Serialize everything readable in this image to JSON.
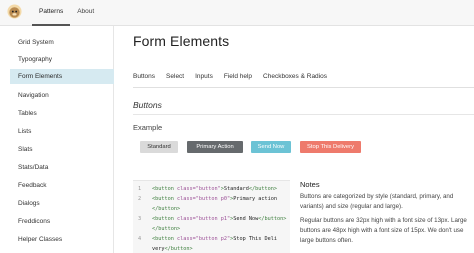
{
  "topnav": {
    "logo_icon": "monkey-logo-icon",
    "items": [
      "Patterns",
      "About"
    ]
  },
  "sidebar": {
    "items": [
      "Grid System",
      "Typography",
      "Form Elements",
      "Navigation",
      "Tables",
      "Lists",
      "Slats",
      "Stats/Data",
      "Feedback",
      "Dialogs",
      "Freddicons",
      "Helper Classes"
    ],
    "active_index": 2
  },
  "main": {
    "title": "Form Elements",
    "tabs": [
      "Buttons",
      "Select",
      "Inputs",
      "Field help",
      "Checkboxes & Radios"
    ],
    "section_title": "Buttons",
    "example_label": "Example",
    "buttons": {
      "standard": "Standard",
      "primary": "Primary Action",
      "send": "Send Now",
      "stop": "Stop This Delivery"
    },
    "colors": {
      "standard": "#dadada",
      "primary": "#666a6d",
      "send": "#6cc3d5",
      "stop": "#ee7a6c",
      "active_nav": "#d6eaf1"
    },
    "code": {
      "line_numbers": [
        "1",
        "2",
        "",
        "3",
        "",
        "4",
        ""
      ],
      "lines": [
        {
          "open": "<button ",
          "attr": "class=\"button\"",
          "close": ">",
          "text": "Standard",
          "end": "</button>"
        },
        {
          "open": "<button ",
          "attr": "class=\"button p0\"",
          "close": ">",
          "text": "Primary action",
          "end": ""
        },
        {
          "open": "",
          "attr": "",
          "close": "",
          "text": "",
          "end": "</button>"
        },
        {
          "open": "<button ",
          "attr": "class=\"button p1\"",
          "close": ">",
          "text": "Send Now",
          "end": "</button>"
        },
        {
          "open": "",
          "attr": "",
          "close": "",
          "text": "",
          "end": "</button>"
        },
        {
          "open": "<button ",
          "attr": "class=\"button p2\"",
          "close": ">",
          "text": "Stop This Deli",
          "end": ""
        },
        {
          "open": "",
          "attr": "",
          "close": "",
          "text": "very",
          "end": "</button>"
        }
      ]
    },
    "notes": {
      "title": "Notes",
      "p1": "Buttons are categorized by style (standard, primary, and variants) and size (regular and large).",
      "p2": "Regular buttons are 32px high with a font size of 13px. Large buttons are 48px high with a font size of 15px. We don't use large buttons often."
    }
  }
}
